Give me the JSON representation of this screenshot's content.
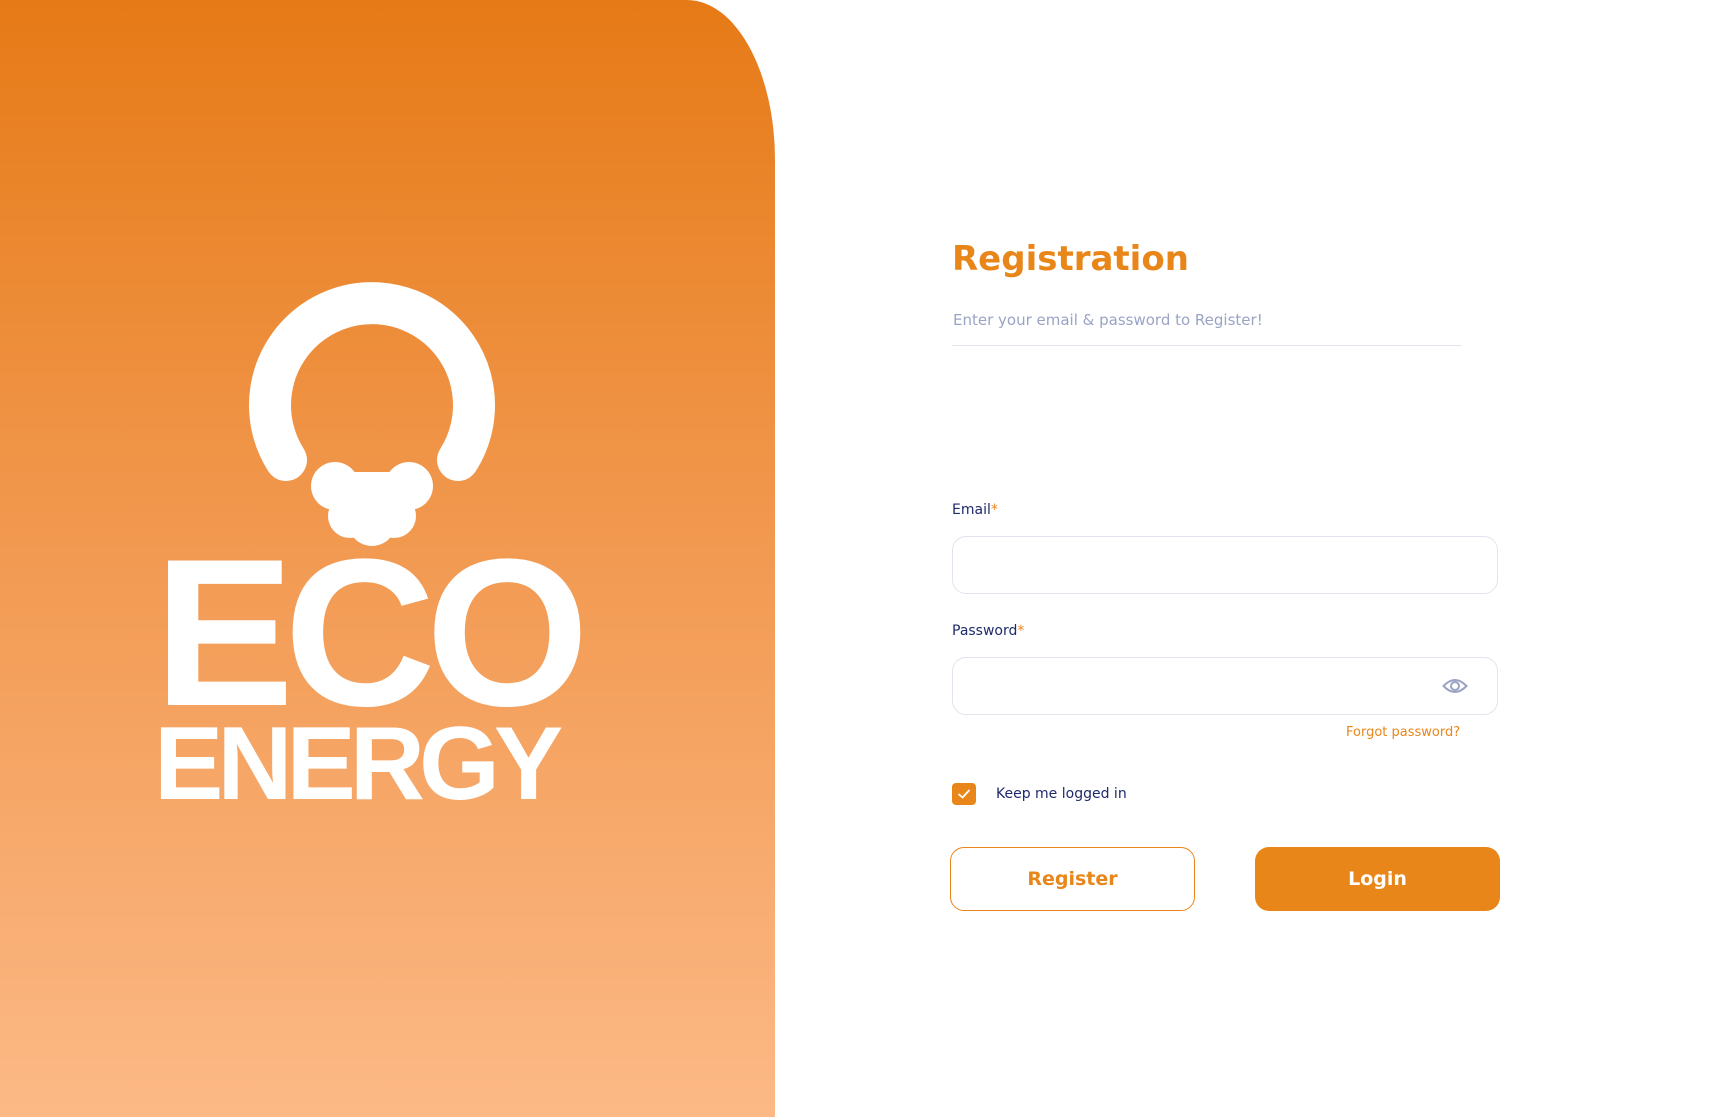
{
  "brand": {
    "logo_line1": "ECO",
    "logo_line2": "ENERGY",
    "gradient_top": "#e67a16",
    "gradient_bottom": "#fcb986"
  },
  "form": {
    "title": "Registration",
    "subtitle": "Enter your email & password to Register!",
    "email": {
      "label": "Email",
      "required_mark": "*",
      "value": ""
    },
    "password": {
      "label": "Password",
      "required_mark": "*",
      "value": "",
      "toggle_icon": "eye-icon"
    },
    "forgot_password": "Forgot password?",
    "remember": {
      "label": "Keep me logged in",
      "checked": true
    },
    "register_button": "Register",
    "login_button": "Login"
  },
  "colors": {
    "accent": "#e8861a",
    "label_text": "#1f2a6b",
    "muted_text": "#9aa3c4",
    "input_border": "#e1e4ec"
  }
}
